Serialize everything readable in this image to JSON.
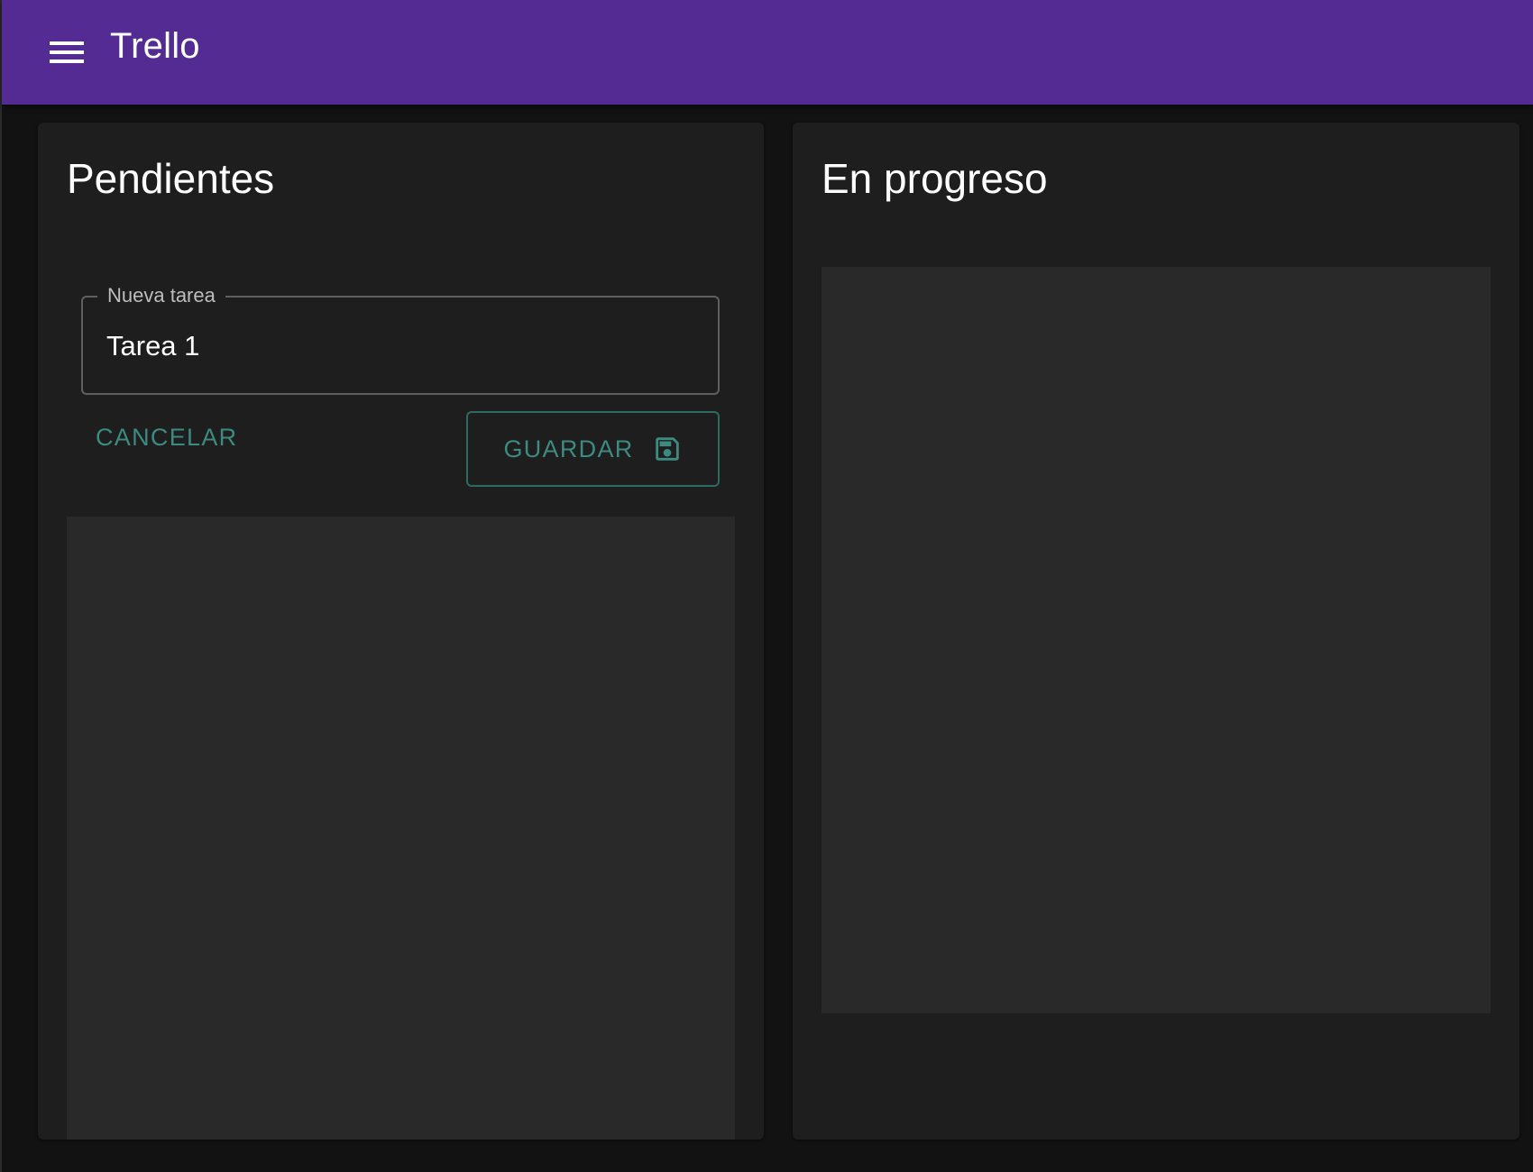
{
  "app": {
    "title": "Trello",
    "menu_icon": "menu-icon",
    "bar_color": "#542a93"
  },
  "columns": [
    {
      "title": "Pendientes",
      "new_task": {
        "label": "Nueva tarea",
        "value": "Tarea 1"
      },
      "cancel_label": "CANCELAR",
      "save_label": "GUARDAR",
      "save_icon": "save-icon",
      "accent_color": "#3d8a80"
    },
    {
      "title": "En progreso"
    }
  ]
}
